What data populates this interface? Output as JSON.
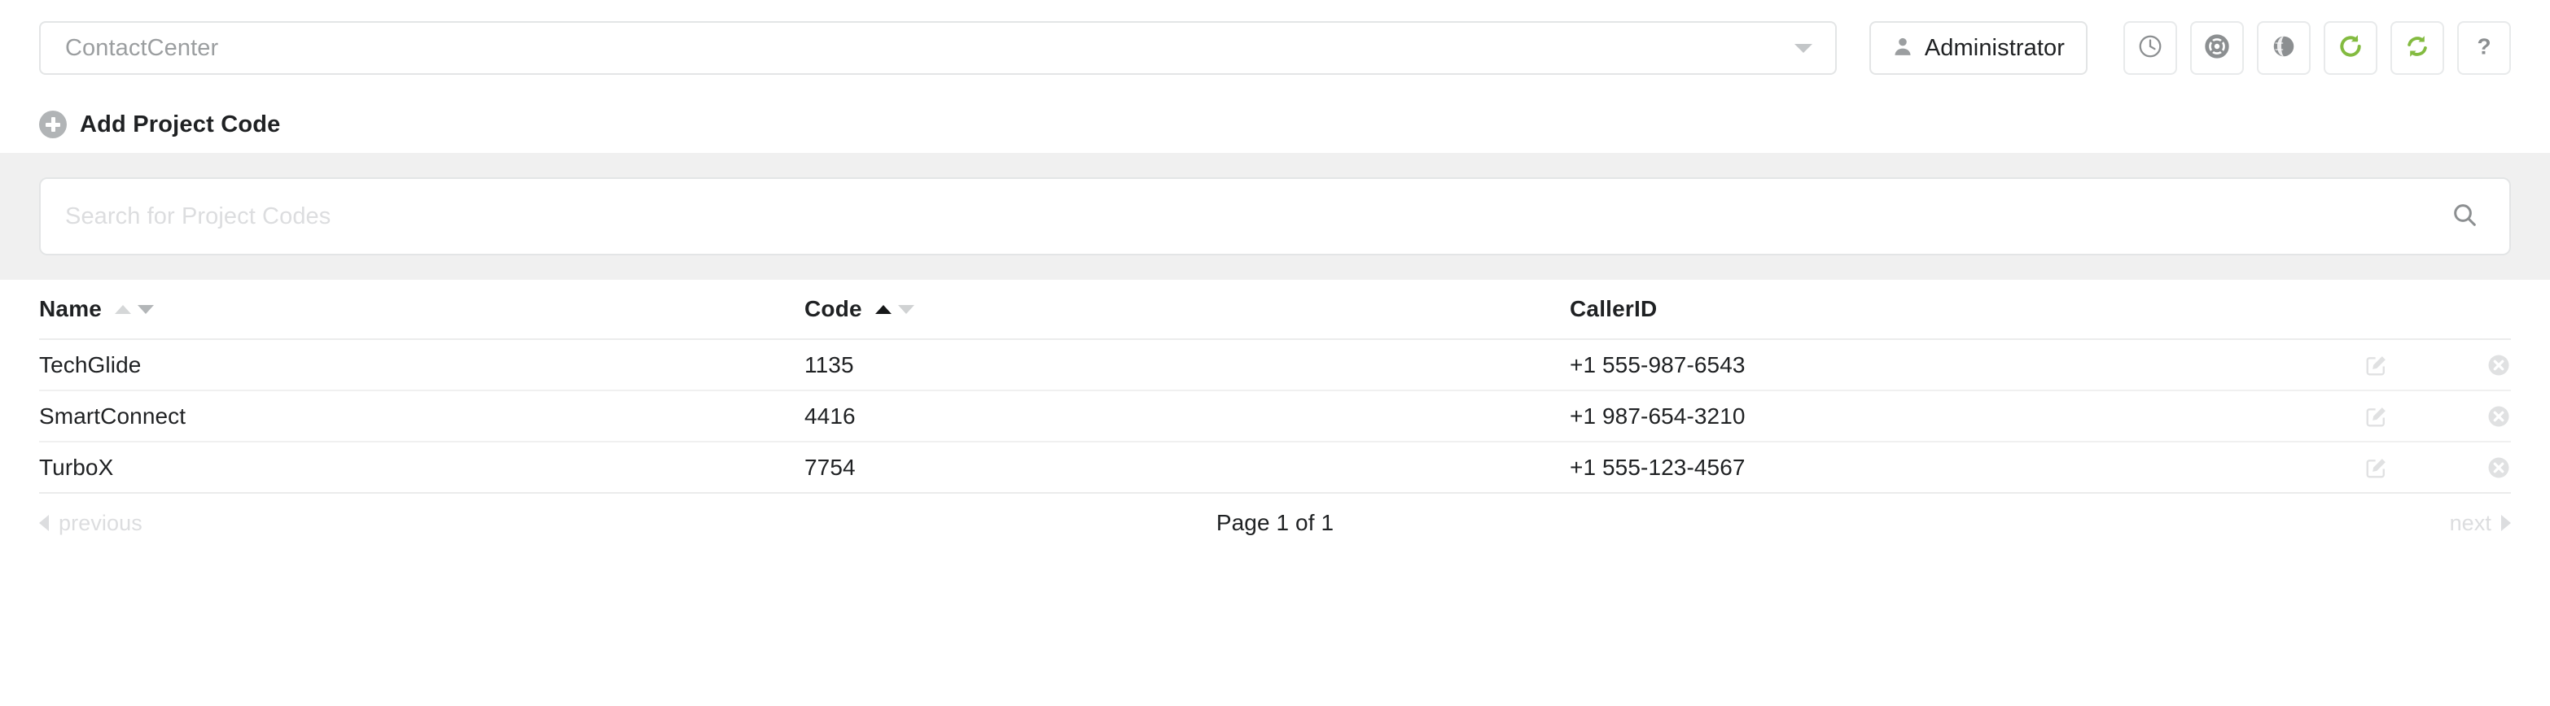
{
  "topbar": {
    "context_select": {
      "value": "ContactCenter",
      "caret_icon": "chevron-down-icon"
    },
    "admin_button": {
      "label": "Administrator",
      "icon": "user-icon"
    },
    "icon_buttons": [
      {
        "name": "clock-icon",
        "title": "History",
        "color": "#8c8f91"
      },
      {
        "name": "lifebuoy-icon",
        "title": "Support",
        "color": "#8c8f91"
      },
      {
        "name": "globe-icon",
        "title": "Language",
        "color": "#8c8f91"
      },
      {
        "name": "refresh-icon",
        "title": "Refresh",
        "color": "#83bb40"
      },
      {
        "name": "sync-icon",
        "title": "Sync",
        "color": "#83bb40"
      },
      {
        "name": "question-icon",
        "title": "Help",
        "color": "#8c8f91"
      }
    ]
  },
  "actions": {
    "add_project_code": {
      "label": "Add Project Code",
      "icon": "plus-circle-icon"
    }
  },
  "search": {
    "placeholder": "Search for Project Codes",
    "value": "",
    "icon": "search-icon"
  },
  "table": {
    "columns": [
      {
        "key": "name",
        "label": "Name",
        "sortable": true,
        "sort_state": "none"
      },
      {
        "key": "code",
        "label": "Code",
        "sortable": true,
        "sort_state": "asc"
      },
      {
        "key": "callerid",
        "label": "CallerID",
        "sortable": false,
        "sort_state": "none"
      }
    ],
    "rows": [
      {
        "name": "TechGlide",
        "code": "1135",
        "callerid": "+1 555-987-6543"
      },
      {
        "name": "SmartConnect",
        "code": "4416",
        "callerid": "+1 987-654-3210"
      },
      {
        "name": "TurboX",
        "code": "7754",
        "callerid": "+1 555-123-4567"
      }
    ],
    "row_actions": [
      {
        "name": "edit-icon",
        "label": "Edit"
      },
      {
        "name": "delete-icon",
        "label": "Delete"
      }
    ]
  },
  "pagination": {
    "previous_label": "previous",
    "next_label": "next",
    "page_info": "Page 1 of 1",
    "current_page": 1,
    "total_pages": 1
  },
  "colors": {
    "accent_green": "#83bb40",
    "band_gray": "#f0f0f0",
    "border_gray": "#e3e5e6",
    "text_dark": "#1f2123",
    "text_muted": "#9b9ea0",
    "text_faint": "#dcdddf"
  }
}
